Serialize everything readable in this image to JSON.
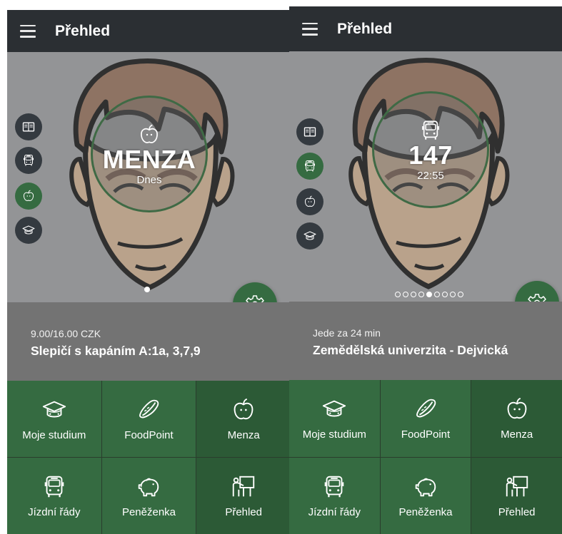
{
  "screens": [
    {
      "appbar": {
        "title": "Přehled"
      },
      "card": {
        "title": "MENZA",
        "subtitle": "Dnes"
      },
      "info": {
        "small": "9.00/16.00 CZK",
        "main": "Slepičí  s kapáním  A:1a, 3,7,9"
      },
      "side_buttons": [
        "moje-studium",
        "jizdni-rady",
        "menza",
        "studium"
      ],
      "active_side": "menza",
      "pager": {
        "total": 1,
        "current": 1
      }
    },
    {
      "appbar": {
        "title": "Přehled"
      },
      "card": {
        "title": "147",
        "subtitle": "22:55"
      },
      "info": {
        "small": "Jede za 24 min",
        "main": "Zemědělská univerzita - Dejvická"
      },
      "side_buttons": [
        "moje-studium",
        "jizdni-rady",
        "menza",
        "studium"
      ],
      "active_side": "jizdni-rady",
      "pager": {
        "total": 9,
        "current": 5
      }
    }
  ],
  "grid": [
    {
      "label": "Moje studium",
      "icon": "graduation-cap-icon"
    },
    {
      "label": "FoodPoint",
      "icon": "hotdog-icon"
    },
    {
      "label": "Menza",
      "icon": "apple-icon"
    },
    {
      "label": "Jízdní řády",
      "icon": "bus-icon"
    },
    {
      "label": "Peněženka",
      "icon": "piggy-bank-icon"
    },
    {
      "label": "Přehled",
      "icon": "presentation-icon"
    }
  ],
  "colors": {
    "primary": "#356b41",
    "appbar": "#2b2f33",
    "info": "#737373"
  }
}
